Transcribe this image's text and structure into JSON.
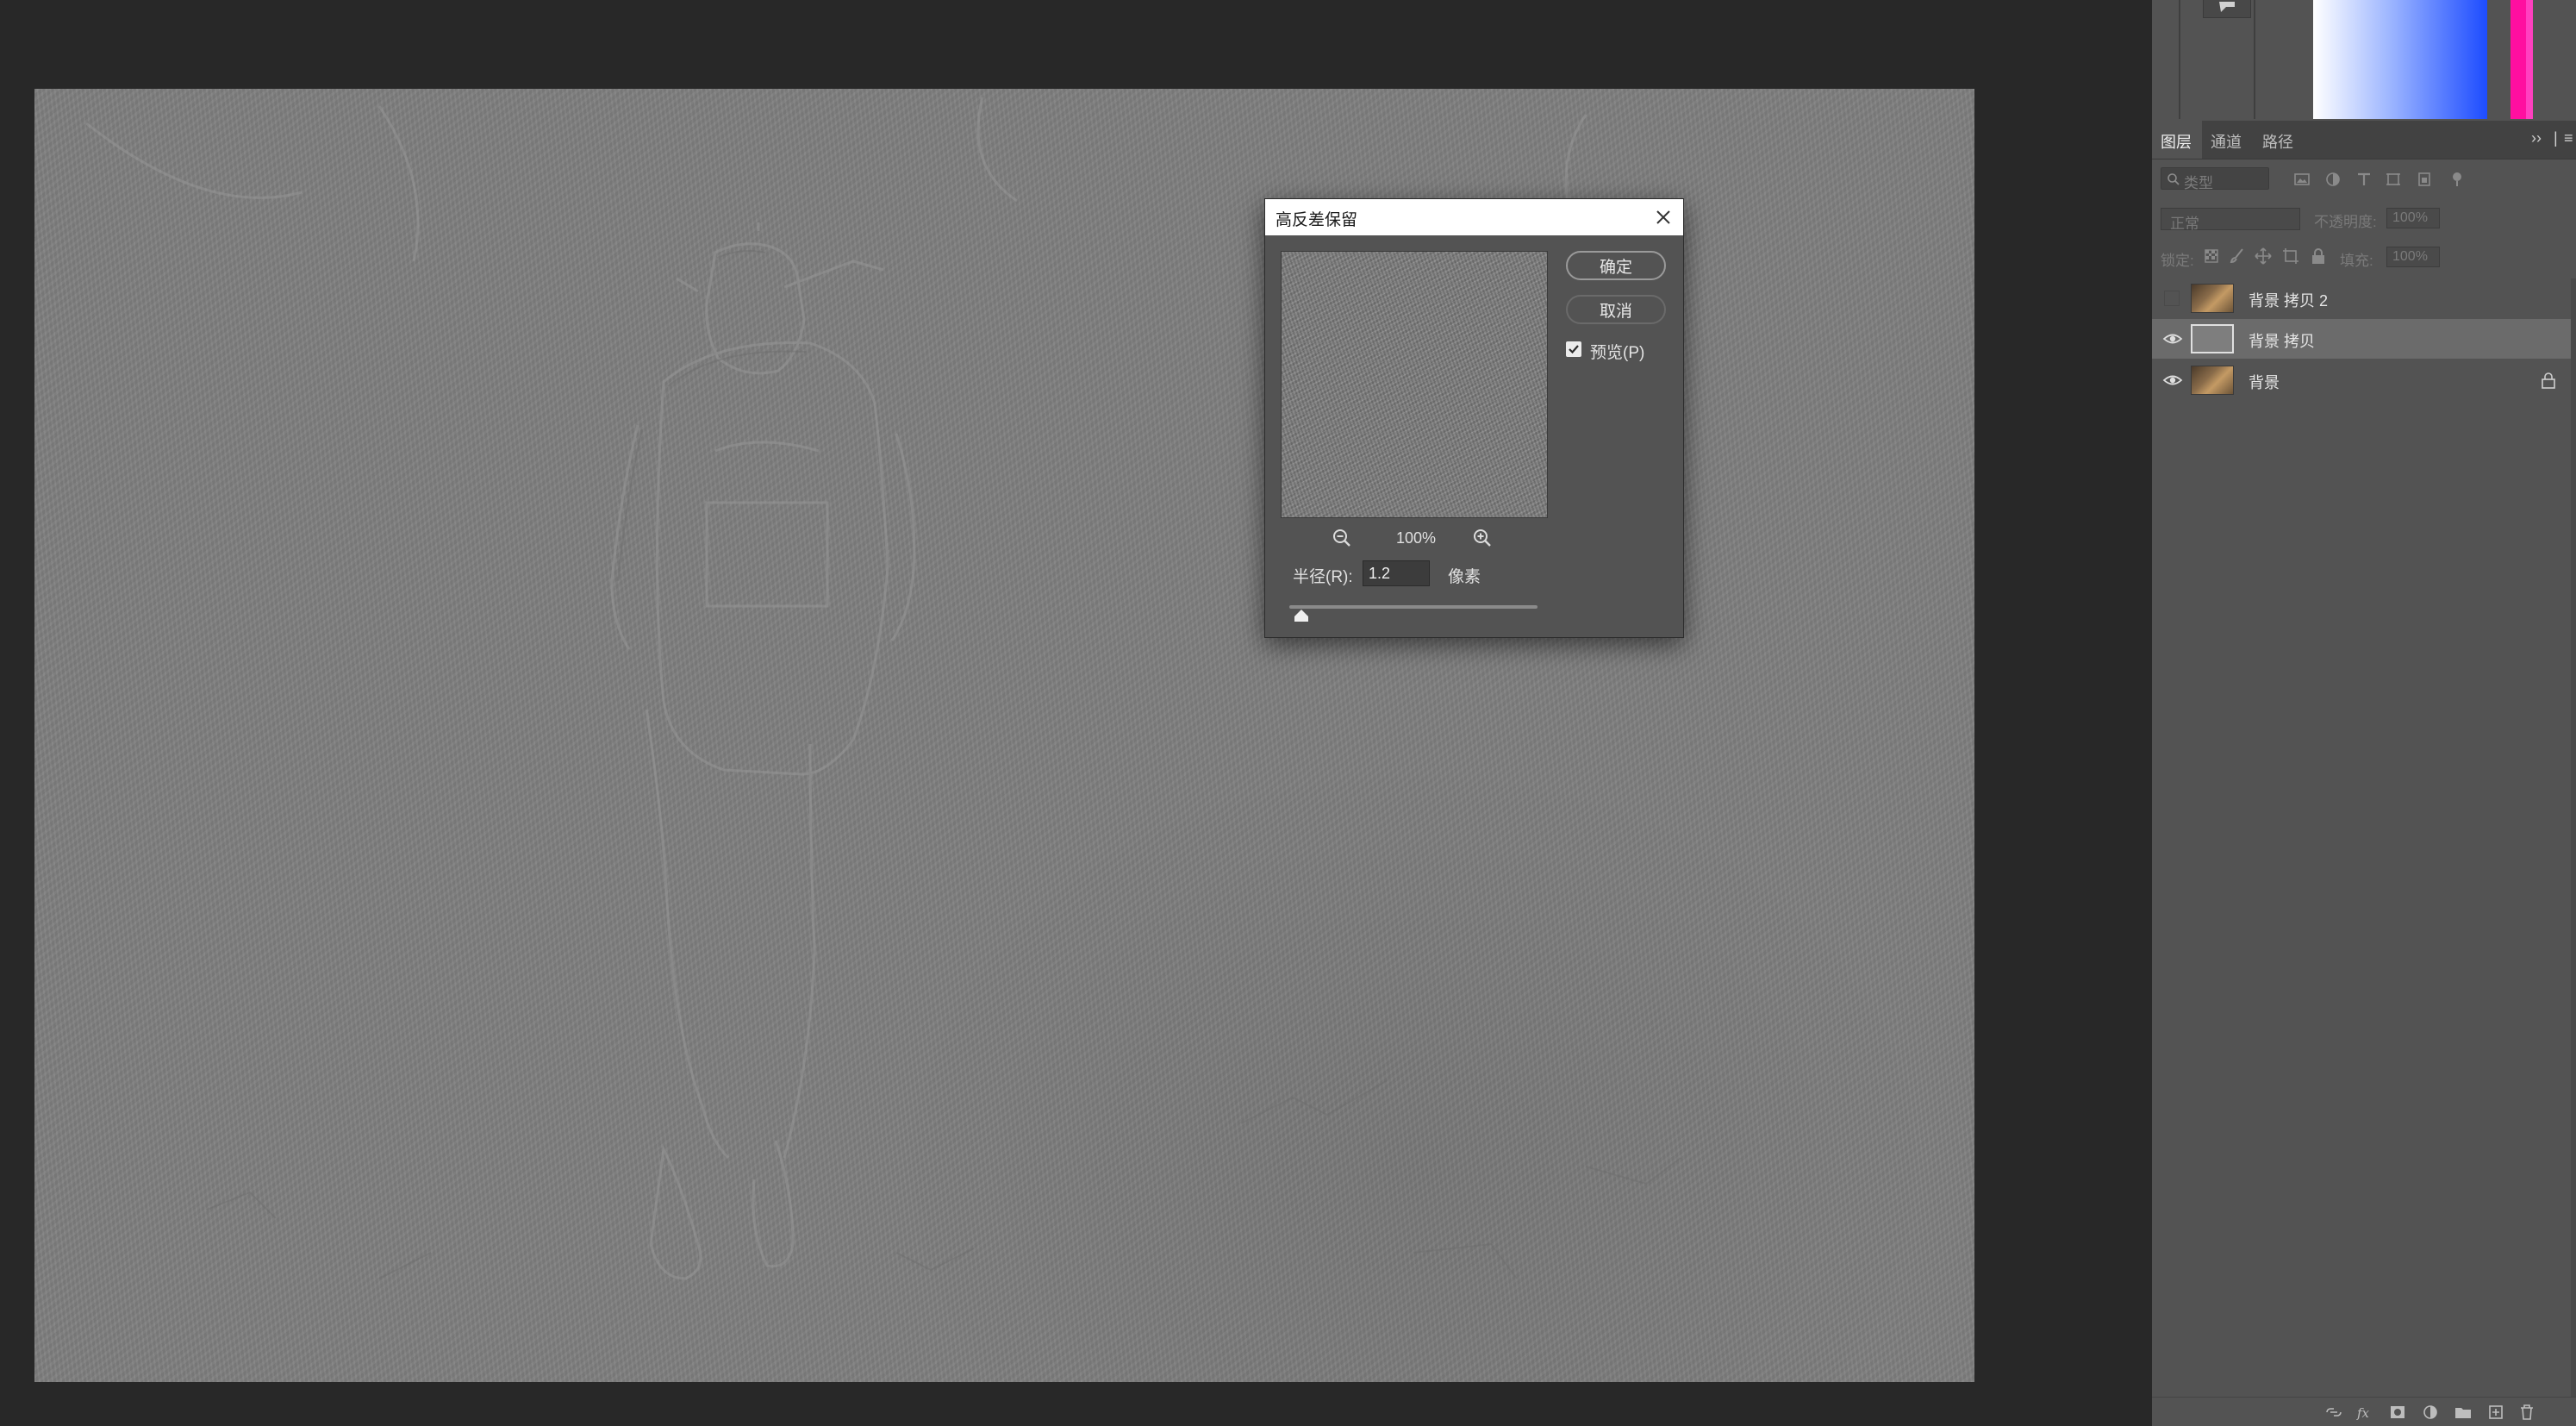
{
  "dialog": {
    "title": "高反差保留",
    "ok_label": "确定",
    "cancel_label": "取消",
    "preview_label": "预览(P)",
    "preview_checked": true,
    "zoom_level": "100%",
    "radius_label": "半径(R):",
    "radius_value": "1.2",
    "radius_unit": "像素",
    "slider_fraction": 0.05
  },
  "layers_panel": {
    "tabs": [
      {
        "label": "图层"
      },
      {
        "label": "通道"
      },
      {
        "label": "路径"
      }
    ],
    "filter_placeholder": "类型",
    "blend_mode": "正常",
    "opacity_label": "不透明度:",
    "opacity_value": "100%",
    "lock_label": "锁定:",
    "fill_label": "填充:",
    "fill_value": "100%",
    "layers": [
      {
        "name": "背景 拷贝 2",
        "visible": false,
        "selected": false,
        "locked": false
      },
      {
        "name": "背景 拷贝",
        "visible": true,
        "selected": true,
        "locked": false
      },
      {
        "name": "背景",
        "visible": true,
        "selected": false,
        "locked": true
      }
    ]
  },
  "colors": {
    "canvas_gray": "#7f7f7f",
    "panel": "#535353",
    "selection": "#6b6b6b",
    "hue_magenta": "#ff0fa0",
    "color_blue": "#1d4cff"
  }
}
